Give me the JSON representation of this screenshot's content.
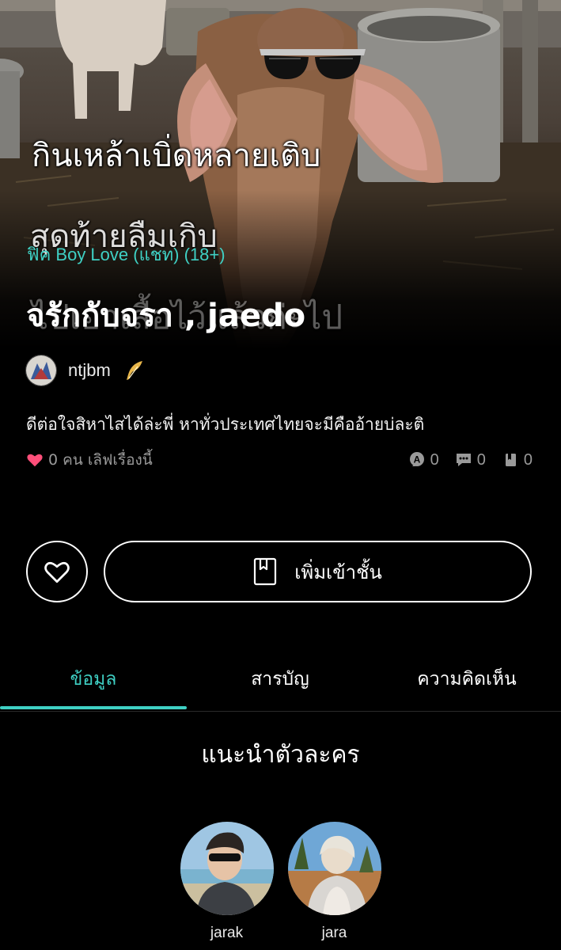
{
  "hero": {
    "meme_lines": [
      "กินเหล้าเบิ่ดหลายเติบ",
      "สุดท้ายลืมเกิบ",
      "ไปเอาเสื้อไว้แล้วก่ะไป"
    ],
    "genre": "ฟิค Boy Love (แชท) (18+)",
    "title": "จรักกับจรา , jaedo"
  },
  "author": {
    "name": "ntjbm",
    "badge_icon": "quill-icon"
  },
  "description": "ดีต่อใจสิหาไสได้ล่ะพี่ หาทั่วประเทศไทยจะมีคืออ้ายบ่ละติ",
  "stats": {
    "love_count": "0",
    "love_label": "คน เลิฟเรื่องนี้",
    "views": "0",
    "comments": "0",
    "bookmarks": "0"
  },
  "actions": {
    "add_to_library": "เพิ่มเข้าชั้น"
  },
  "tabs": [
    {
      "label": "ข้อมูล",
      "active": true
    },
    {
      "label": "สารบัญ",
      "active": false
    },
    {
      "label": "ความคิดเห็น",
      "active": false
    }
  ],
  "characters_section": {
    "title": "แนะนำตัวละคร",
    "characters": [
      {
        "name": "jarak"
      },
      {
        "name": "jara"
      }
    ]
  },
  "colors": {
    "accent": "#3fd0c4",
    "heart": "#ff4f7a",
    "background": "#000000"
  }
}
